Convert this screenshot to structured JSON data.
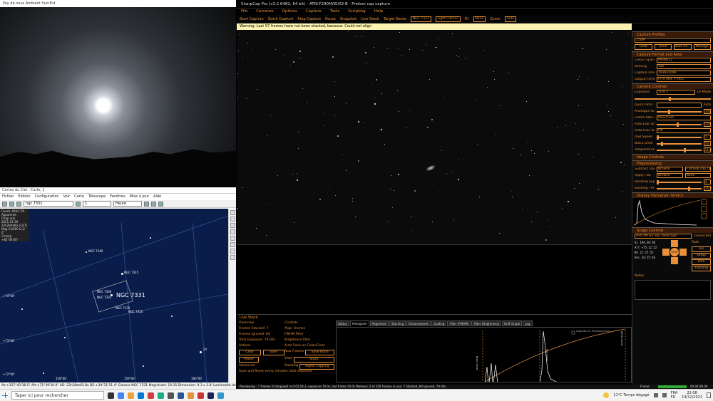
{
  "allsky": {
    "title": "Pay de nous Ambient Sud-Est"
  },
  "cdc": {
    "title": "Cartes du Ciel - Carte_1",
    "menu": [
      "Fichier",
      "Edition",
      "Configuration",
      "Voir",
      "Carte",
      "Télescope",
      "Fenêtres",
      "Mise à jour",
      "Aide"
    ],
    "search": "ngc 7331",
    "time_field": "1",
    "unit": "Heure",
    "info": [
      "Coord. AltAz T/A",
      "Apparente",
      "Chap vrai",
      "2021-12-19",
      "22h29m06s (CET)",
      "Mag:12/S00 0,1/ 0°",
      "Champ +85°04'00\""
    ],
    "labels": {
      "ngc7331_big": "NGC 7331",
      "ngc7320": "NGC 7320",
      "ngc7340": "NGC 7340",
      "ngc7315": "NGC 7315",
      "ngc7335": "NGC 7335",
      "ngc7336": "NGC 7336",
      "ngc7331s": "NGC 7331",
      "ngc7305": "NGC 7305",
      "n24": "24"
    },
    "dec_labels": [
      "+74°00'",
      "+73°00'",
      "+72°00'"
    ],
    "ra_labels": [
      "158°00'",
      "159°00'",
      "160°00'"
    ],
    "status": "Az:+157°43'38.5\" Alt:+71°39'30.0\"   AD: 22h38m03.8s DE:+34°31'51.4\"   Galaxie NGC 7331  Magnitude: 10.35  Dimension: 9.3 x 3.8'  Luminosité de surface"
  },
  "sharpcap": {
    "title": "SharpCap Pro (v3.2.6482, 64 bit) - ATIK-F290M/ID/02-B - Profam cap capture",
    "menu": [
      "File",
      "Cameras",
      "Options",
      "Capture",
      "Tools",
      "Scripting",
      "Help"
    ],
    "toolbar": {
      "start": "Start Capture",
      "quick": "Quick Capture",
      "stop": "Stop Capture",
      "pause": "Pause",
      "snapshot": "Snapshot",
      "livestack": "Live Stack",
      "target_label": "Target Name",
      "target": "NGC 7331",
      "frames": "Light Frames",
      "fit_label": "Fit",
      "fit": "None",
      "zoom_label": "Zoom",
      "zoom": "Auto"
    },
    "warning": "Warning: Last 57 frames have not been stacked, because: Could not align",
    "panel": {
      "cap_profiles": "Capture Profiles",
      "profile": "250M",
      "profile_buttons": [
        "Load",
        "Save",
        "Save As...",
        "Manage"
      ],
      "cap_format": "Capture Format and Area",
      "format_rows": [
        {
          "k": "Colour Space",
          "v": "MONO12"
        },
        {
          "k": "Binning",
          "v": "1x1"
        },
        {
          "k": "Capture Area",
          "v": "1936x1096"
        },
        {
          "k": "Output Format",
          "v": "FITS files (*.fits)"
        }
      ],
      "cam_controls": "Camera Controls",
      "exposure_label": "Exposure",
      "exposure": "10,0 s",
      "lx_mode": "LX Mode",
      "quick_picks": "Quick Picks",
      "auto": "Auto",
      "gain_label": "Analogue Gain",
      "gain": "200",
      "frame_rate_label": "Frame Rate Limit",
      "frame_rate": "Maximum",
      "auto_exp_label": "Auto Exp Target",
      "auto_exp": "120",
      "auto_gain_label": "Auto Gain with Auto Exposure",
      "auto_gain": "Off",
      "usb_label": "USB Speed",
      "usb": "1",
      "black_label": "Black Level",
      "black": "50",
      "temp_label": "Temperature",
      "temp": "21.0",
      "img_controls": "Image Controls",
      "preprocessing": "Preprocessing",
      "subtract_dark_label": "Subtract Dark",
      "subtract_dark": "Browse",
      "dark_file": "F:\\sharp cap captur...",
      "apply_flat_label": "Apply Flat",
      "apply_flat": "Browse",
      "flat_file": "None",
      "banding_label": "Banding Suppression",
      "banding": "0",
      "banding_thr_label": "Banding Threshold",
      "banding_thr": "35.0",
      "hist_stretch": "Display Histogram Stretch",
      "scope": "Scope Controls",
      "scope_name": "ASCOM GS Sky Telescope",
      "connected": "Connected",
      "coords": [
        "Az  194:30:30",
        "Alt +75:12:52",
        "RA  22:37:55",
        "Dec 34:25:46"
      ],
      "rate_label": "Rate",
      "rate": "Fas",
      "setup": "Setup",
      "park": "Park",
      "tracking": "Tracking",
      "stop": "STOP",
      "notes": "Notes"
    },
    "livestack": {
      "title": "Live Stack",
      "overview": "Overview",
      "stacked": "Frames Stacked: 7",
      "ignored": "Frames Ignored: 84",
      "total": "Total Exposure: 70.00s",
      "actions": "Actions",
      "clear": "Clear",
      "save": "Save",
      "pause": "Pause",
      "advanced": "Advanced",
      "save_reset": "Save and Reset every",
      "minutes": "minutes total exposure",
      "controls": "Controls",
      "align": "Align Frames",
      "fwhm": "FWHM Filter",
      "brightness": "Brightness Filter",
      "autosave": "Auto Save on Clear/Close",
      "raw_label": "Raw Frames",
      "raw": "Save None",
      "view_label": "View",
      "view": "Stack",
      "stacking_label": "Stacking",
      "stacking": "Sigma Clipping",
      "tabs": [
        "Status",
        "Histogram",
        "Alignment",
        "Stacking",
        "Enhancement",
        "Guiding",
        "Filter (FWHM)",
        "Filter (Brightness)",
        "Drift Graph",
        "Log"
      ],
      "log_hist": "Logarithmic Horizontal Axis",
      "black_level": "Black Level",
      "white_level": "White Level",
      "mid_level": "Mid Level"
    },
    "status": "Previewing : 7 frames (0 dropped) in 0:01:54.2, exposure 70.0s, last frame 70.0s   Memory: 2 of 256 frames in use.   7 Stacked, 84 Ignored, 70.00s",
    "frame_label": "Frame:",
    "fps": "00:04:09.09",
    "colors": {
      "accent": "#e8913a"
    }
  },
  "taskbar": {
    "search": "Taper ici pour rechercher",
    "weather": "11°C  Temps dégagé",
    "lang": "FRA",
    "layout": "FR",
    "time": "22:08",
    "date": "19/12/2021"
  }
}
